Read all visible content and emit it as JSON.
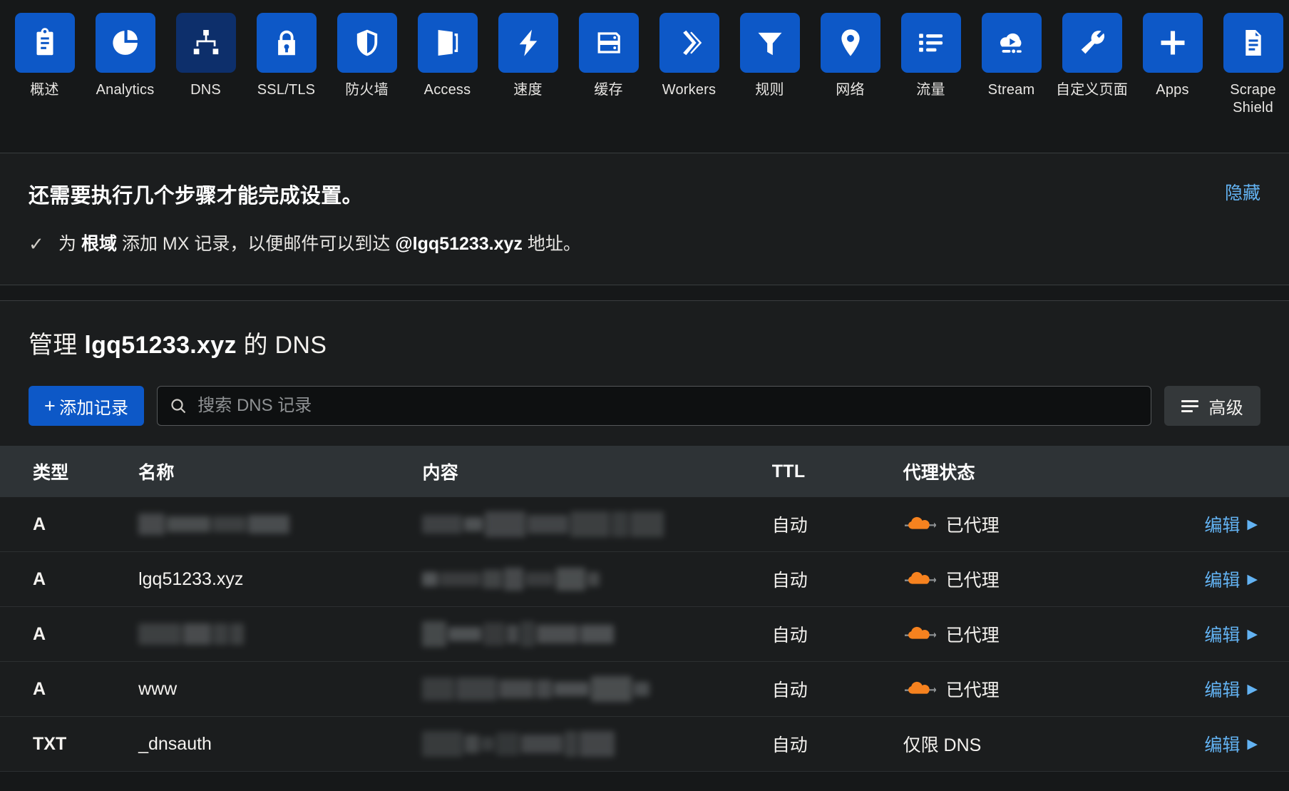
{
  "nav": {
    "items": [
      {
        "label": "概述",
        "icon": "clipboard-icon",
        "active": false
      },
      {
        "label": "Analytics",
        "icon": "pie-chart-icon",
        "active": false
      },
      {
        "label": "DNS",
        "icon": "sitemap-icon",
        "active": true
      },
      {
        "label": "SSL/TLS",
        "icon": "lock-icon",
        "active": false
      },
      {
        "label": "防火墙",
        "icon": "shield-icon",
        "active": false
      },
      {
        "label": "Access",
        "icon": "door-icon",
        "active": false
      },
      {
        "label": "速度",
        "icon": "lightning-icon",
        "active": false
      },
      {
        "label": "缓存",
        "icon": "server-icon",
        "active": false
      },
      {
        "label": "Workers",
        "icon": "chevrons-icon",
        "active": false
      },
      {
        "label": "规则",
        "icon": "funnel-icon",
        "active": false
      },
      {
        "label": "网络",
        "icon": "map-pin-icon",
        "active": false
      },
      {
        "label": "流量",
        "icon": "list-icon",
        "active": false
      },
      {
        "label": "Stream",
        "icon": "cloud-play-icon",
        "active": false
      },
      {
        "label": "自定义页面",
        "icon": "wrench-icon",
        "active": false
      },
      {
        "label": "Apps",
        "icon": "plus-icon",
        "active": false
      },
      {
        "label": "Scrape Shield",
        "icon": "document-icon",
        "active": false
      }
    ]
  },
  "banner": {
    "title": "还需要执行几个步骤才能完成设置。",
    "hide_label": "隐藏",
    "item": {
      "check": "✓",
      "prefix": "为",
      "bold1": "根域",
      "middle": "添加 MX 记录，以便邮件可以到达",
      "bold2": "@lgq51233.xyz",
      "suffix": "地址。"
    }
  },
  "dns": {
    "title_prefix": "管理",
    "title_domain": "lgq51233.xyz",
    "title_suffix": "的 DNS",
    "add_record_label": "添加记录",
    "add_record_plus": "+",
    "search_placeholder": "搜索 DNS 记录",
    "search_value": "",
    "advanced_label": "高级",
    "columns": [
      "类型",
      "名称",
      "内容",
      "TTL",
      "代理状态",
      ""
    ],
    "rows": [
      {
        "type": "A",
        "name": "",
        "name_redacted": true,
        "content": "",
        "content_redacted": true,
        "ttl": "自动",
        "proxy": "已代理",
        "proxied": true,
        "edit": "编辑"
      },
      {
        "type": "A",
        "name": "lgq51233.xyz",
        "name_redacted": false,
        "content": "",
        "content_redacted": true,
        "ttl": "自动",
        "proxy": "已代理",
        "proxied": true,
        "edit": "编辑"
      },
      {
        "type": "A",
        "name": "",
        "name_redacted": true,
        "content": "",
        "content_redacted": true,
        "ttl": "自动",
        "proxy": "已代理",
        "proxied": true,
        "edit": "编辑"
      },
      {
        "type": "A",
        "name": "www",
        "name_redacted": false,
        "content": "",
        "content_redacted": true,
        "ttl": "自动",
        "proxy": "已代理",
        "proxied": true,
        "edit": "编辑"
      },
      {
        "type": "TXT",
        "name": "_dnsauth",
        "name_redacted": false,
        "content": "",
        "content_redacted": true,
        "ttl": "自动",
        "proxy": "仅限 DNS",
        "proxied": false,
        "edit": "编辑"
      }
    ],
    "edit_caret": "▶"
  },
  "colors": {
    "page_bg": "#161819",
    "card_bg": "#1b1d1e",
    "nav_tile": "#0d58c7",
    "nav_tile_active": "#0d2f6b",
    "link": "#63b3f3",
    "table_header_bg": "#2e3336",
    "proxy_cloud": "#f6821f"
  }
}
